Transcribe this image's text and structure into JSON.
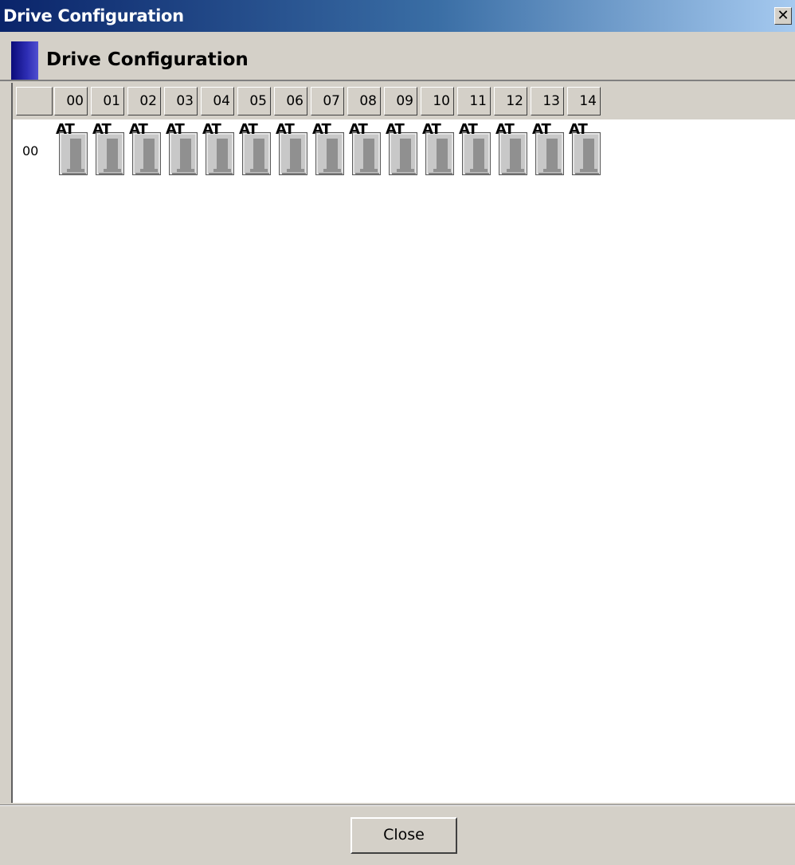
{
  "window": {
    "title": "Drive Configuration",
    "close_glyph": "✕"
  },
  "header": {
    "title": "Drive Configuration"
  },
  "grid": {
    "columns": [
      "00",
      "01",
      "02",
      "03",
      "04",
      "05",
      "06",
      "07",
      "08",
      "09",
      "10",
      "11",
      "12",
      "13",
      "14"
    ],
    "rows": [
      {
        "label": "00",
        "drives": [
          {
            "type": "AT",
            "icon": "disk-drive-icon"
          },
          {
            "type": "AT",
            "icon": "disk-drive-icon"
          },
          {
            "type": "AT",
            "icon": "disk-drive-icon"
          },
          {
            "type": "AT",
            "icon": "disk-drive-icon"
          },
          {
            "type": "AT",
            "icon": "disk-drive-icon"
          },
          {
            "type": "AT",
            "icon": "disk-drive-icon"
          },
          {
            "type": "AT",
            "icon": "disk-drive-icon"
          },
          {
            "type": "AT",
            "icon": "disk-drive-icon"
          },
          {
            "type": "AT",
            "icon": "disk-drive-icon"
          },
          {
            "type": "AT",
            "icon": "disk-drive-icon"
          },
          {
            "type": "AT",
            "icon": "disk-drive-icon"
          },
          {
            "type": "AT",
            "icon": "disk-drive-icon"
          },
          {
            "type": "AT",
            "icon": "disk-drive-icon"
          },
          {
            "type": "AT",
            "icon": "disk-drive-icon"
          },
          {
            "type": "AT",
            "icon": "disk-drive-icon"
          }
        ]
      }
    ]
  },
  "footer": {
    "close_label": "Close"
  },
  "colors": {
    "titlebar_start": "#0a246a",
    "accent": "#2e2eb5",
    "dialog_face": "#d4d0c8",
    "drive_face": "#c8c8c8",
    "drive_shadow": "#909090"
  }
}
